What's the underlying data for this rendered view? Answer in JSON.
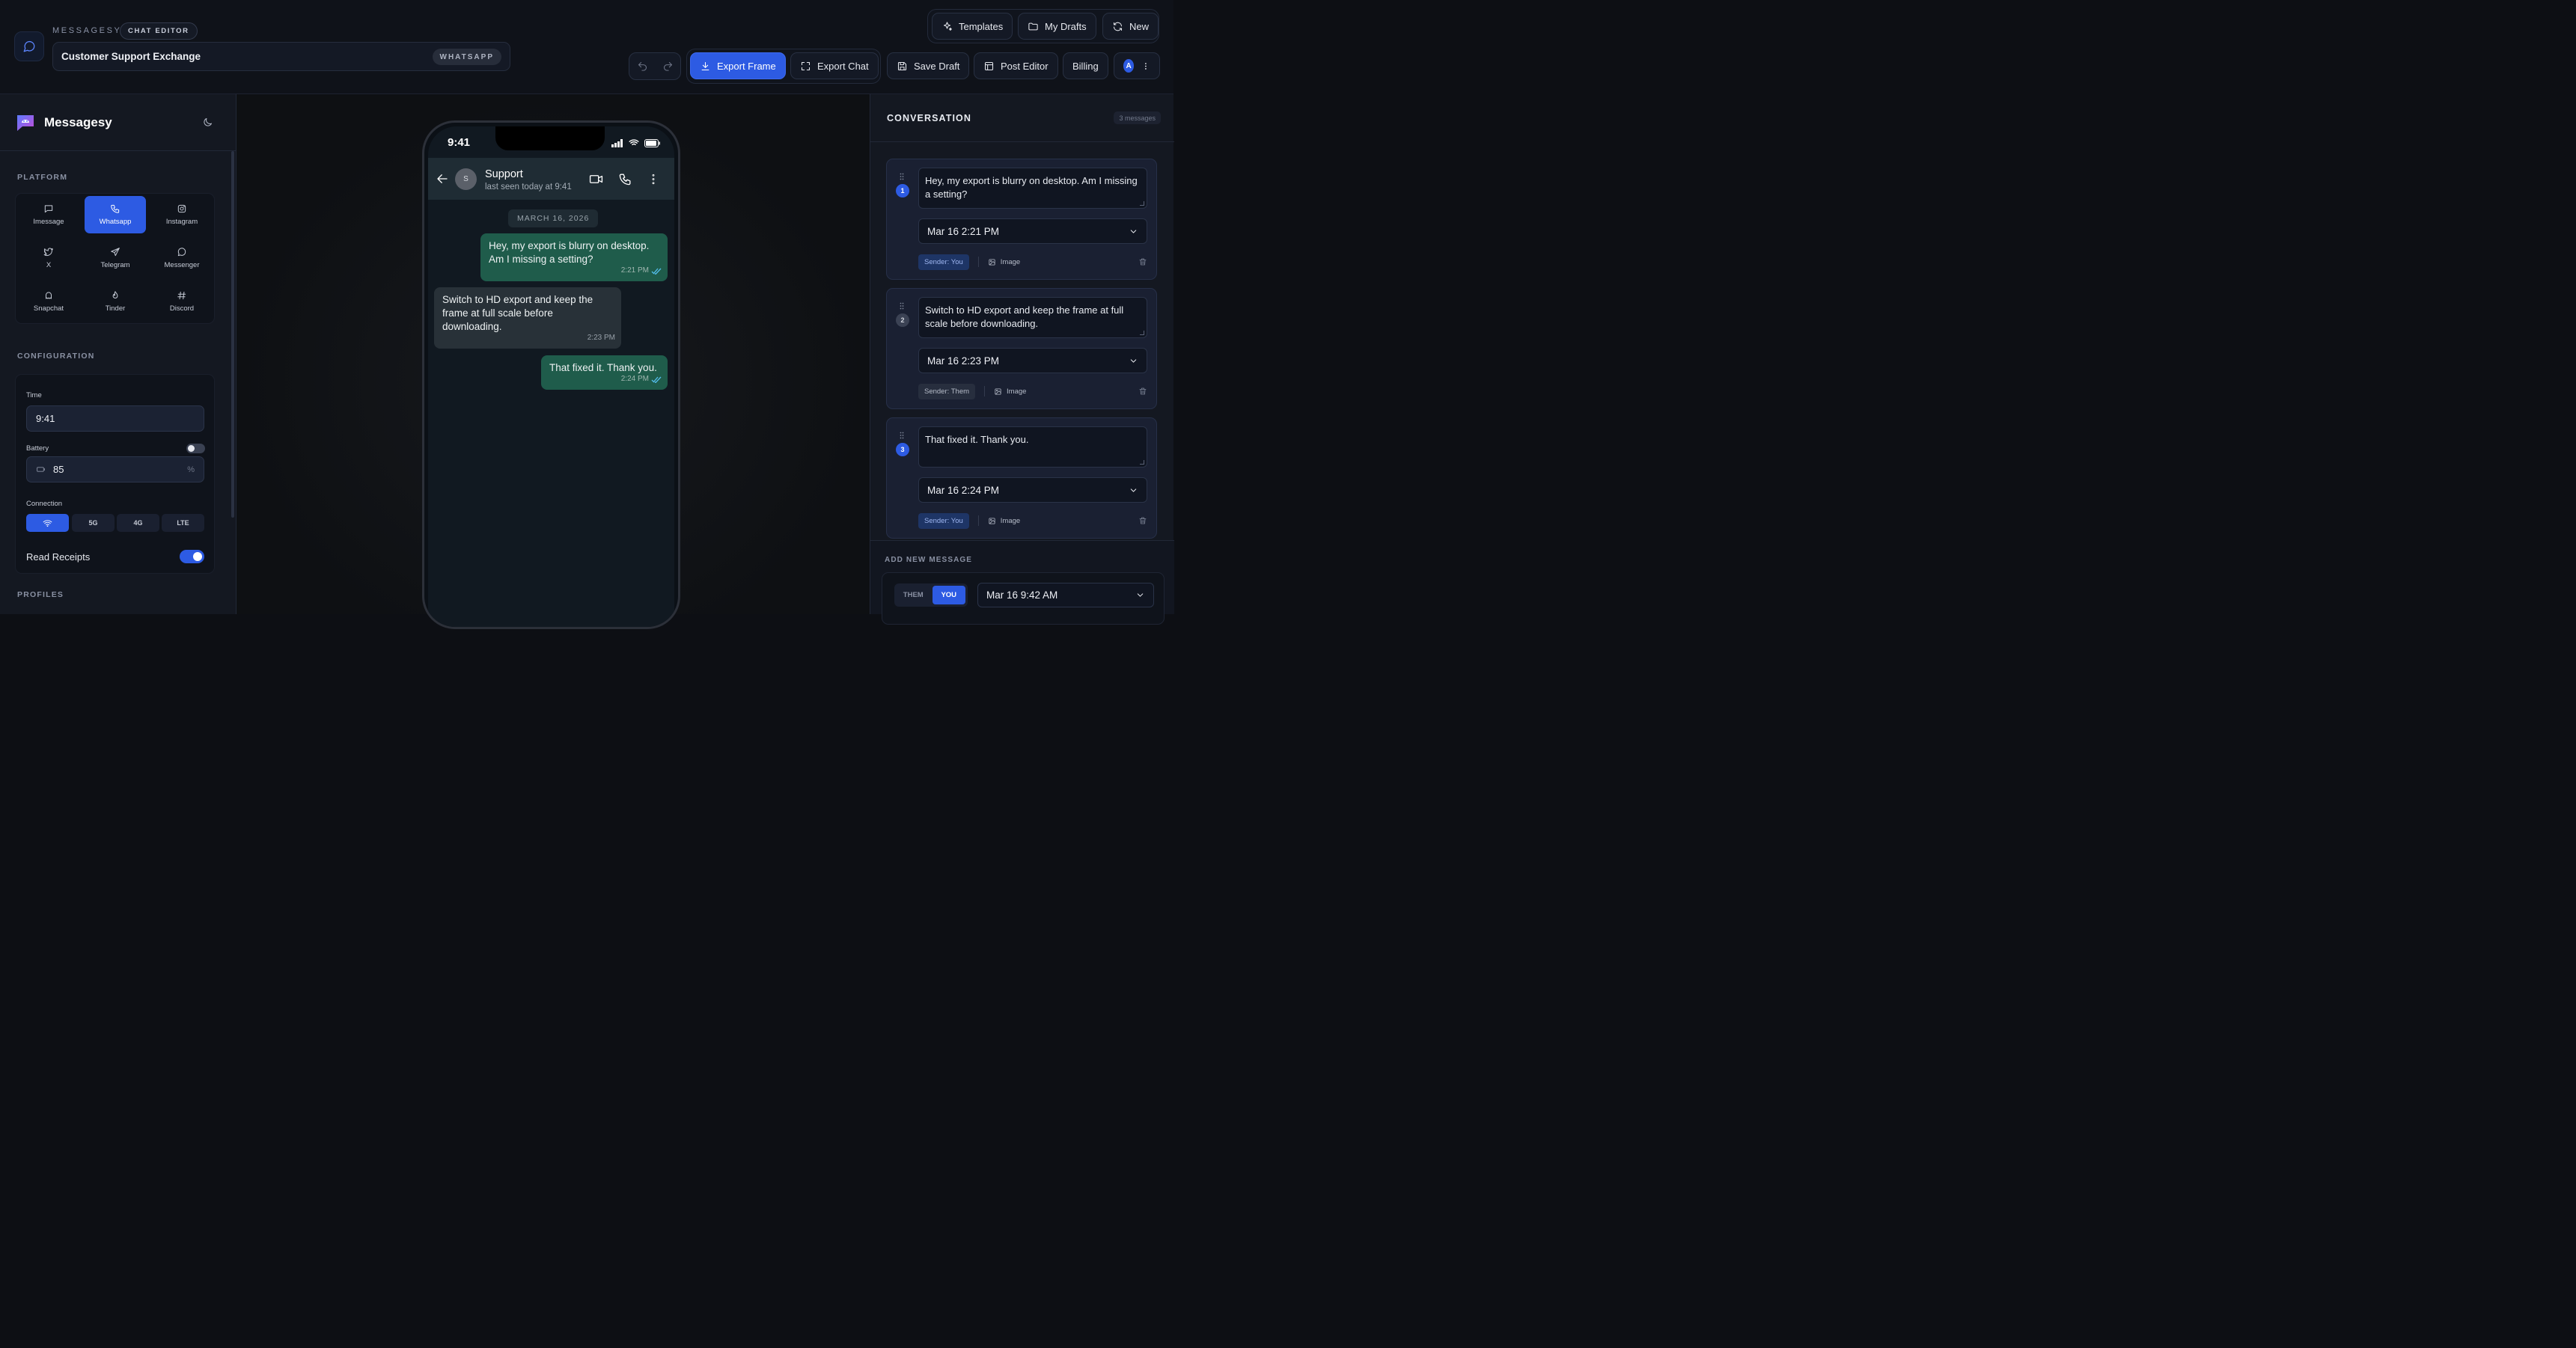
{
  "topbar": {
    "brand_caps": "MESSAGESY",
    "editor_badge": "CHAT EDITOR",
    "chat_title": "Customer Support Exchange",
    "platform_badge": "WHATSAPP",
    "templates": "Templates",
    "my_drafts": "My Drafts",
    "new": "New",
    "export_frame": "Export Frame",
    "export_chat": "Export Chat",
    "save_draft": "Save Draft",
    "post_editor": "Post Editor",
    "billing": "Billing",
    "account_initial": "A"
  },
  "sidebar": {
    "app_name": "Messagesy",
    "platform_label": "PLATFORM",
    "platforms": [
      {
        "label": "Imessage",
        "icon": "message-square-icon"
      },
      {
        "label": "Whatsapp",
        "icon": "phone-icon",
        "active": true
      },
      {
        "label": "Instagram",
        "icon": "instagram-icon"
      },
      {
        "label": "X",
        "icon": "twitter-icon"
      },
      {
        "label": "Telegram",
        "icon": "send-icon"
      },
      {
        "label": "Messenger",
        "icon": "message-circle-icon"
      },
      {
        "label": "Snapchat",
        "icon": "ghost-icon"
      },
      {
        "label": "Tinder",
        "icon": "flame-icon"
      },
      {
        "label": "Discord",
        "icon": "hash-icon"
      }
    ],
    "config_label": "CONFIGURATION",
    "time_label": "Time",
    "time_value": "9:41",
    "battery_label": "Battery",
    "battery_value": "85",
    "battery_unit": "%",
    "connection_label": "Connection",
    "connections": [
      "wifi",
      "5G",
      "4G",
      "LTE"
    ],
    "read_receipts_label": "Read Receipts",
    "profiles_label": "PROFILES"
  },
  "phone": {
    "status_time": "9:41",
    "contact_name": "Support",
    "contact_initial": "S",
    "contact_status": "last seen today at 9:41",
    "date_chip": "MARCH 16, 2026",
    "messages": [
      {
        "text": "Hey, my export is blurry on desktop. Am I missing a setting?",
        "time": "2:21 PM",
        "sender": "you"
      },
      {
        "text": "Switch to HD export and keep the frame at full scale before downloading.",
        "time": "2:23 PM",
        "sender": "them"
      },
      {
        "text": "That fixed it. Thank you.",
        "time": "2:24 PM",
        "sender": "you"
      }
    ]
  },
  "conversation": {
    "title": "CONVERSATION",
    "count": "3 messages",
    "items": [
      {
        "num": "1",
        "text": "Hey, my export is blurry on desktop. Am I missing a setting?",
        "datetime": "Mar 16 2:21 PM",
        "sender": "Sender: You",
        "image": "Image"
      },
      {
        "num": "2",
        "text": "Switch to HD export and keep the frame at full scale before downloading.",
        "datetime": "Mar 16 2:23 PM",
        "sender": "Sender: Them",
        "image": "Image"
      },
      {
        "num": "3",
        "text": "That fixed it. Thank you.",
        "datetime": "Mar 16 2:24 PM",
        "sender": "Sender: You",
        "image": "Image"
      }
    ],
    "add_label": "ADD NEW MESSAGE",
    "them": "THEM",
    "you": "YOU",
    "new_datetime": "Mar 16 9:42 AM"
  },
  "colors": {
    "accent": "#2d5be3",
    "outgoing_bubble": "#1f5c4b",
    "incoming_bubble": "#283138"
  }
}
